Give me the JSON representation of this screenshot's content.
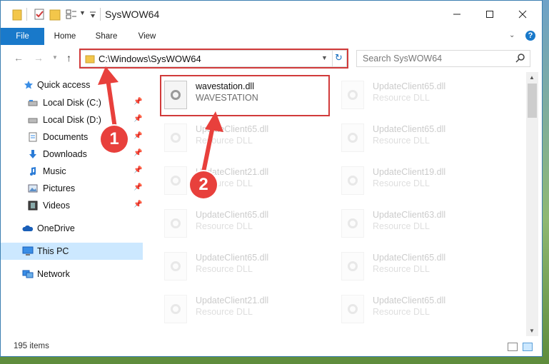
{
  "window": {
    "title": "SysWOW64"
  },
  "ribbon": {
    "tabs": [
      "File",
      "Home",
      "Share",
      "View"
    ]
  },
  "address": {
    "path": "C:\\Windows\\SysWOW64"
  },
  "search": {
    "placeholder": "Search SysWOW64"
  },
  "sidebar": {
    "items": [
      {
        "label": "Quick access",
        "icon": "star-icon"
      },
      {
        "label": "Local Disk (C:)",
        "icon": "drive-icon"
      },
      {
        "label": "Local Disk (D:)",
        "icon": "drive-icon"
      },
      {
        "label": "Documents",
        "icon": "documents-icon"
      },
      {
        "label": "Downloads",
        "icon": "download-icon"
      },
      {
        "label": "Music",
        "icon": "music-icon"
      },
      {
        "label": "Pictures",
        "icon": "pictures-icon"
      },
      {
        "label": "Videos",
        "icon": "videos-icon"
      },
      {
        "label": "OneDrive",
        "icon": "cloud-icon"
      },
      {
        "label": "This PC",
        "icon": "computer-icon"
      },
      {
        "label": "Network",
        "icon": "network-icon"
      }
    ]
  },
  "files": [
    {
      "name": "wavestation.dll",
      "desc": "WAVESTATION"
    },
    {
      "name": "UpdateClient65.dll",
      "desc": "Resource DLL"
    },
    {
      "name": "UpdateClient65.dll",
      "desc": "Resource DLL"
    },
    {
      "name": "UpdateClient65.dll",
      "desc": "Resource DLL"
    },
    {
      "name": "UpdateClient21.dll",
      "desc": "Resource DLL"
    },
    {
      "name": "UpdateClient19.dll",
      "desc": "Resource DLL"
    },
    {
      "name": "UpdateClient65.dll",
      "desc": "Resource DLL"
    },
    {
      "name": "UpdateClient63.dll",
      "desc": "Resource DLL"
    },
    {
      "name": "UpdateClient65.dll",
      "desc": "Resource DLL"
    },
    {
      "name": "UpdateClient65.dll",
      "desc": "Resource DLL"
    },
    {
      "name": "UpdateClient21.dll",
      "desc": "Resource DLL"
    },
    {
      "name": "UpdateClient65.dll",
      "desc": "Resource DLL"
    }
  ],
  "status": {
    "items": "195 items"
  },
  "annotations": {
    "step1": "1",
    "step2": "2"
  },
  "colors": {
    "accent": "#1979ca",
    "highlight": "#d13a3a",
    "selected": "#cce8ff"
  }
}
